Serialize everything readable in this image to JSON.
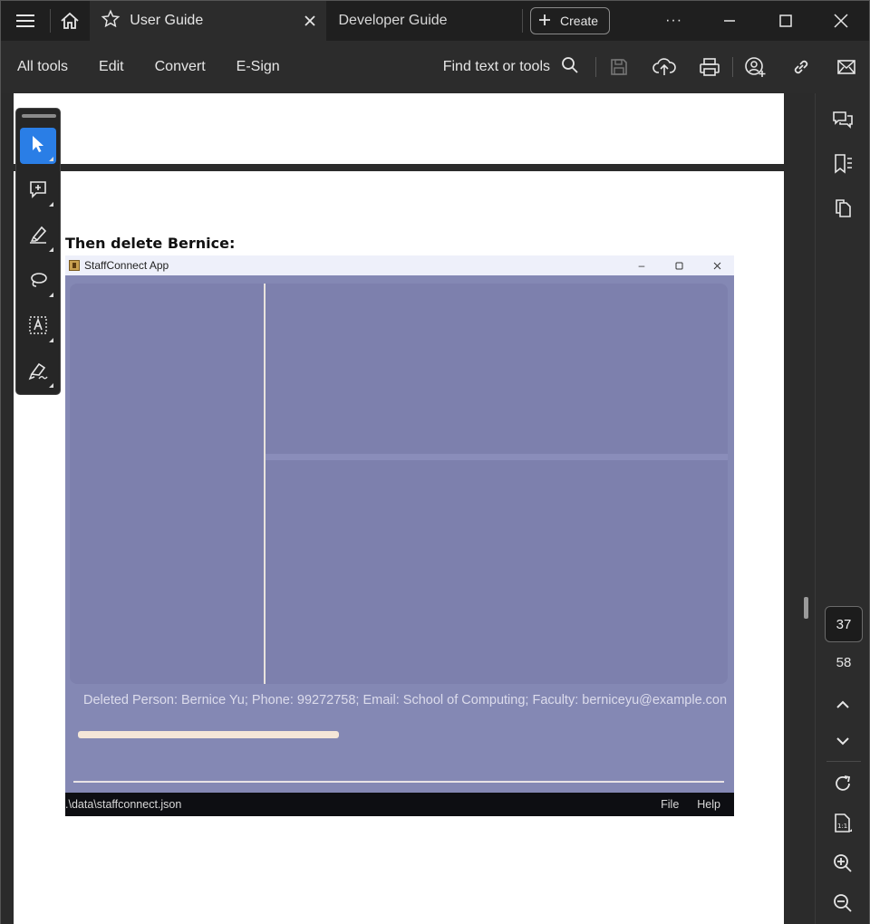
{
  "titlebar": {
    "tabs": [
      {
        "label": "User Guide",
        "active": true
      },
      {
        "label": "Developer Guide",
        "active": false
      }
    ],
    "create_label": "Create",
    "more_label": "···"
  },
  "toolbar": {
    "menu": [
      "All tools",
      "Edit",
      "Convert",
      "E-Sign"
    ],
    "find_label": "Find text or tools"
  },
  "document": {
    "heading": "Then delete Bernice:",
    "screenshot": {
      "window_title": "StaffConnect App",
      "result_text": "Deleted Person: Bernice Yu; Phone: 99272758; Email: School of Computing; Faculty: berniceyu@example.con",
      "status_path": ".\\data\\staffconnect.json",
      "status_menus": [
        "File",
        "Help"
      ]
    }
  },
  "navigation": {
    "current_page": "37",
    "total_pages": "58"
  },
  "colors": {
    "accent": "#2a7ee6",
    "app_background": "#8488b4",
    "panel": "#7d80ad"
  }
}
